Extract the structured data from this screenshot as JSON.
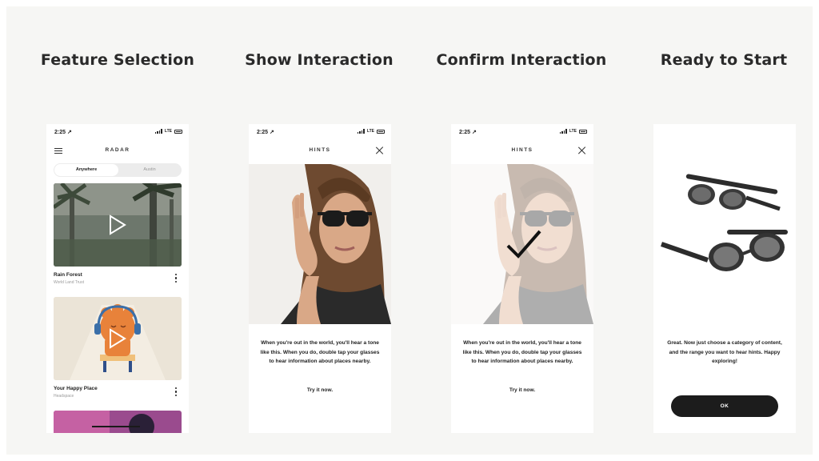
{
  "headings": {
    "feature": "Feature Selection",
    "show": "Show Interaction",
    "confirm": "Confirm Interaction",
    "ready": "Ready to Start"
  },
  "status": {
    "time": "2:25 ↗",
    "network": "LTE"
  },
  "radar": {
    "title": "RADAR",
    "tabs": {
      "active": "Anywhere",
      "inactive": "Austin"
    },
    "cards": [
      {
        "title": "Rain Forest",
        "subtitle": "World Land Trust"
      },
      {
        "title": "Your Happy Place",
        "subtitle": "Headspace"
      }
    ]
  },
  "hints": {
    "title": "HINTS",
    "body": "When you're out in the world, you'll hear a tone like this. When you do, double tap your glasses to hear information about places nearby.",
    "cta": "Try it now."
  },
  "ready": {
    "body": "Great. Now just choose a category of content, and the range you want to hear hints. Happy exploring!",
    "button": "OK"
  },
  "colors": {
    "background": "#f6f6f4",
    "button": "#1c1c1c",
    "accent_orange": "#e8823a",
    "headphones_blue": "#3b6fa8"
  },
  "icons": [
    "menu-icon",
    "close-icon",
    "play-icon",
    "more-vertical-icon",
    "checkmark-icon",
    "signal-icon",
    "battery-icon"
  ]
}
